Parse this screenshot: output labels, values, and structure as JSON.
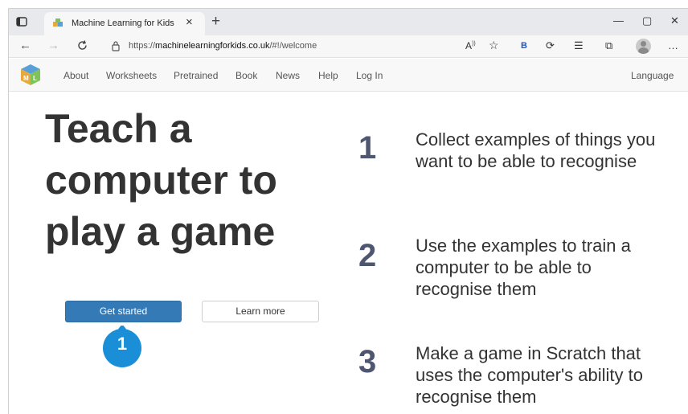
{
  "browser": {
    "tab_title": "Machine Learning for Kids",
    "tab_close": "×",
    "new_tab": "+",
    "minimize": "—",
    "maximize": "▢",
    "close": "✕",
    "back": "←",
    "forward": "→",
    "refresh": "C",
    "url_prefix": "https://",
    "url_host": "machinelearningforkids.co.uk",
    "url_path": "/#!/welcome",
    "read_aloud": "A̅)",
    "favorite": "☆",
    "ext_b": "B",
    "ext_puzzle": "⟳",
    "favorites_bar": "☰",
    "collections": "⧉",
    "more": "…"
  },
  "nav": {
    "items": [
      "About",
      "Worksheets",
      "Pretrained",
      "Book",
      "News",
      "Help",
      "Log In"
    ],
    "language": "Language"
  },
  "hero": {
    "title": "Teach a computer to play a game",
    "primary_button": "Get started",
    "secondary_button": "Learn more"
  },
  "callout": {
    "number": "1"
  },
  "steps": [
    {
      "number": "1",
      "text": "Collect examples of things you want to be able to recognise"
    },
    {
      "number": "2",
      "text": "Use the examples to train a computer to be able to recognise them"
    },
    {
      "number": "3",
      "text": "Make a game in Scratch that uses the computer's ability to recognise them"
    }
  ],
  "colors": {
    "primary": "#337ab7",
    "callout": "#1a8ed6",
    "step_number": "#4e5670"
  }
}
